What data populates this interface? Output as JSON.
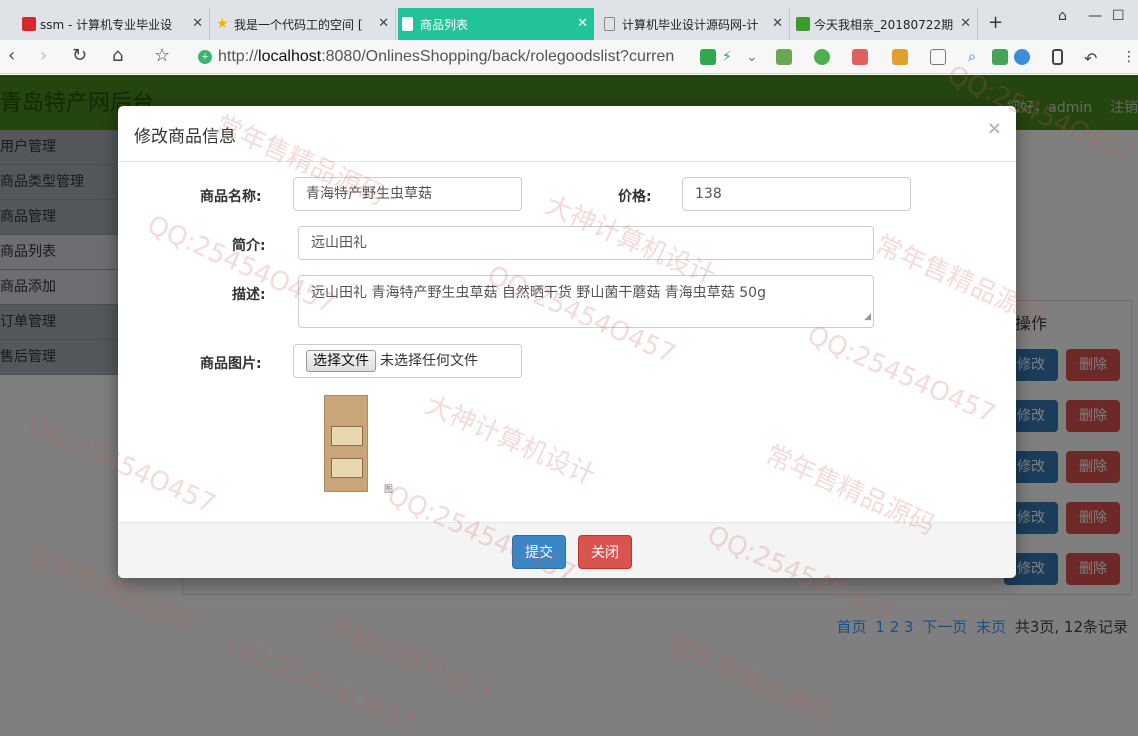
{
  "browser": {
    "tabs": [
      {
        "title": "ssm - 计算机专业毕业设",
        "active": false,
        "icon": "red-logo-icon",
        "color": "#d9272e"
      },
      {
        "title": "我是一个代码工的空间 [",
        "active": false,
        "icon": "star-icon",
        "color": "#f0b400"
      },
      {
        "title": "商品列表",
        "active": true,
        "icon": "page-icon",
        "color": "#ffffff"
      },
      {
        "title": "计算机毕业设计源码网-计",
        "active": false,
        "icon": "page-icon",
        "color": "#888888"
      },
      {
        "title": "今天我相亲_20180722期",
        "active": false,
        "icon": "video-icon",
        "color": "#3b9b2f"
      }
    ],
    "new_tab": "+",
    "url_prefix": "http://",
    "url_host": "localhost",
    "url_rest": ":8080/OnlinesShopping/back/rolegoodslist?curren"
  },
  "app": {
    "title": "青岛特产网后台",
    "user_greeting": "您好，admin",
    "logout": "注销",
    "sidebar": [
      {
        "label": "用户管理",
        "dark": true
      },
      {
        "label": "商品类型管理",
        "dark": true
      },
      {
        "label": "商品管理",
        "dark": true
      },
      {
        "label": "商品列表",
        "dark": false
      },
      {
        "label": "商品添加",
        "dark": false
      },
      {
        "label": "订单管理",
        "dark": true
      },
      {
        "label": "售后管理",
        "dark": true
      }
    ],
    "table_op_header": "操作",
    "row_edit": "修改",
    "row_delete": "删除",
    "pager": {
      "first": "首页",
      "pages": [
        "1",
        "2",
        "3"
      ],
      "next": "下一页",
      "last": "末页",
      "summary": "共3页, 12条记录"
    }
  },
  "modal": {
    "title": "修改商品信息",
    "close": "×",
    "name_label": "商品名称:",
    "name_value": "青海特产野生虫草菇",
    "price_label": "价格:",
    "price_value": "138",
    "intro_label": "简介:",
    "intro_value": "远山田礼",
    "desc_label": "描述:",
    "desc_value": "远山田礼 青海特产野生虫草菇 自然晒干货 野山菌干蘑菇 青海虫草菇 50g",
    "image_label": "商品图片:",
    "file_button": "选择文件",
    "file_status": "未选择任何文件",
    "image_alt": "图",
    "submit": "提交",
    "cancel": "关闭"
  },
  "watermarks": [
    "常年售精品源码",
    "QQ:25454O457",
    "大神计算机设计"
  ]
}
